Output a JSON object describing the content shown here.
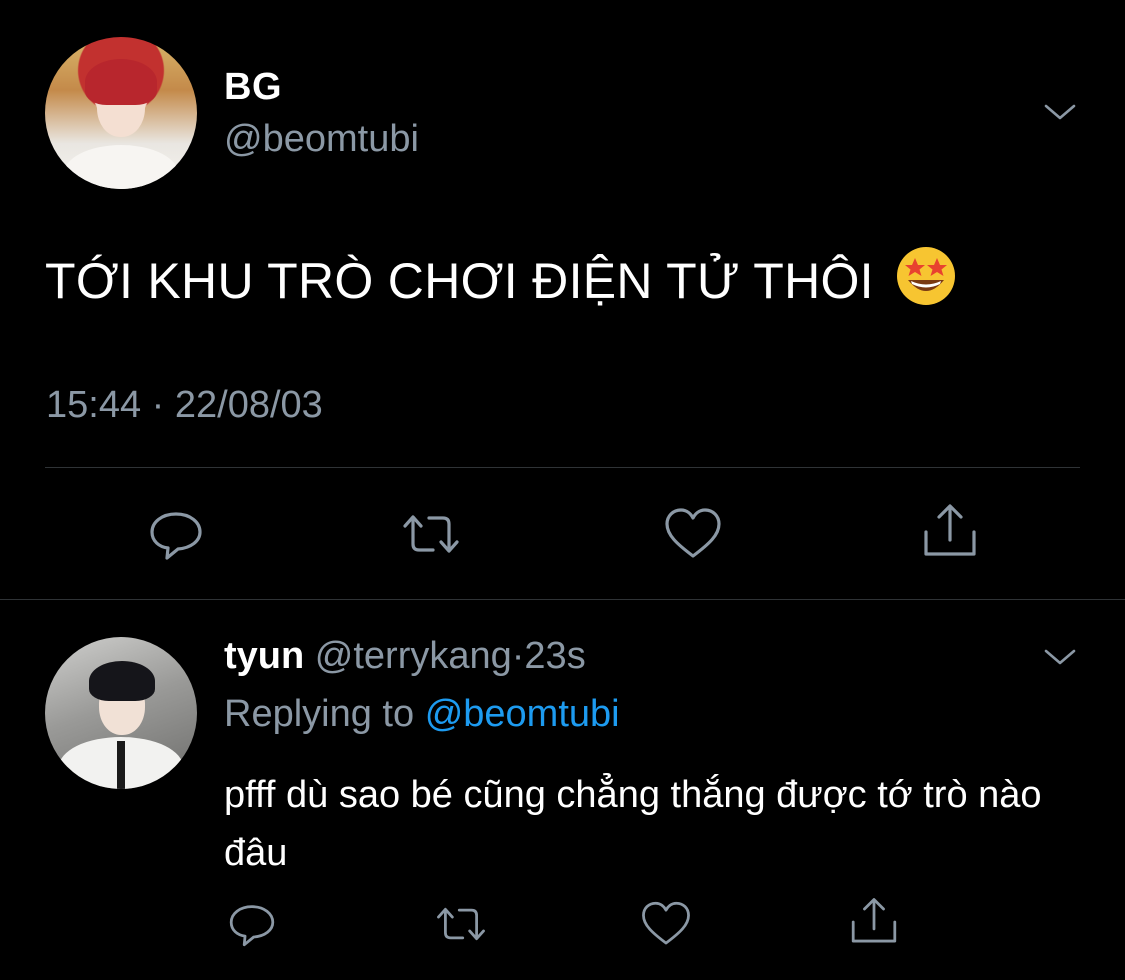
{
  "main_tweet": {
    "display_name": "BG",
    "handle": "@beomtubi",
    "text": "TỚI KHU TRÒ CHƠI ĐIỆN TỬ THÔI",
    "emoji": "star-struck-emoji",
    "timestamp": "15:44 · 22/08/03",
    "actions": [
      "reply-icon",
      "retweet-icon",
      "like-icon",
      "share-icon"
    ]
  },
  "reply_tweet": {
    "display_name": "tyun",
    "handle": "@terrykang",
    "separator": "·",
    "age": "23s",
    "replying_prefix": "Replying to",
    "replying_mention": "@beomtubi",
    "text": "pfff dù sao bé cũng chẳng thắng được tớ trò nào đâu",
    "actions": [
      "reply-icon",
      "retweet-icon",
      "like-icon",
      "share-icon"
    ]
  },
  "colors": {
    "background": "#000000",
    "primary_text": "#ffffff",
    "secondary_text": "#8b98a5",
    "link": "#1d9bf0",
    "divider": "#2f3336"
  }
}
